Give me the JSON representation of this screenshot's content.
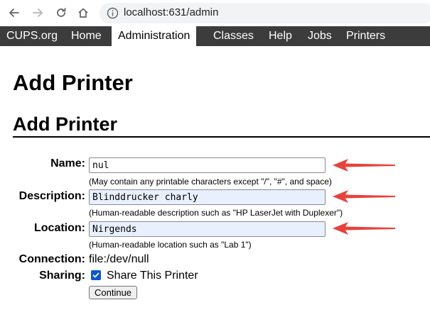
{
  "browser": {
    "url": "localhost:631/admin",
    "icons": [
      "back-arrow-icon",
      "forward-arrow-icon",
      "reload-icon",
      "home-icon",
      "info-icon"
    ]
  },
  "nav": {
    "brand": "CUPS.org",
    "items": [
      "Home",
      "Administration",
      "Classes",
      "Help",
      "Jobs",
      "Printers"
    ],
    "active": "Administration"
  },
  "page": {
    "title": "Add Printer",
    "section_title": "Add Printer"
  },
  "form": {
    "name_label": "Name:",
    "name_value": "nul",
    "name_hint": "(May contain any printable characters except \"/\", \"#\", and space)",
    "description_label": "Description:",
    "description_value": "Blinddrucker charly",
    "description_hint": "(Human-readable description such as \"HP LaserJet with Duplexer\")",
    "location_label": "Location:",
    "location_value": "Nirgends",
    "location_hint": "(Human-readable location such as \"Lab 1\")",
    "connection_label": "Connection:",
    "connection_value": "file:/dev/null",
    "sharing_label": "Sharing:",
    "sharing_checked": true,
    "sharing_text": "Share This Printer",
    "continue_label": "Continue"
  },
  "colors": {
    "nav_bg": "#3c3c3c",
    "arrow": "#e8423a",
    "autofill_bg": "#e8f0fe",
    "checkbox": "#0b57d0"
  }
}
